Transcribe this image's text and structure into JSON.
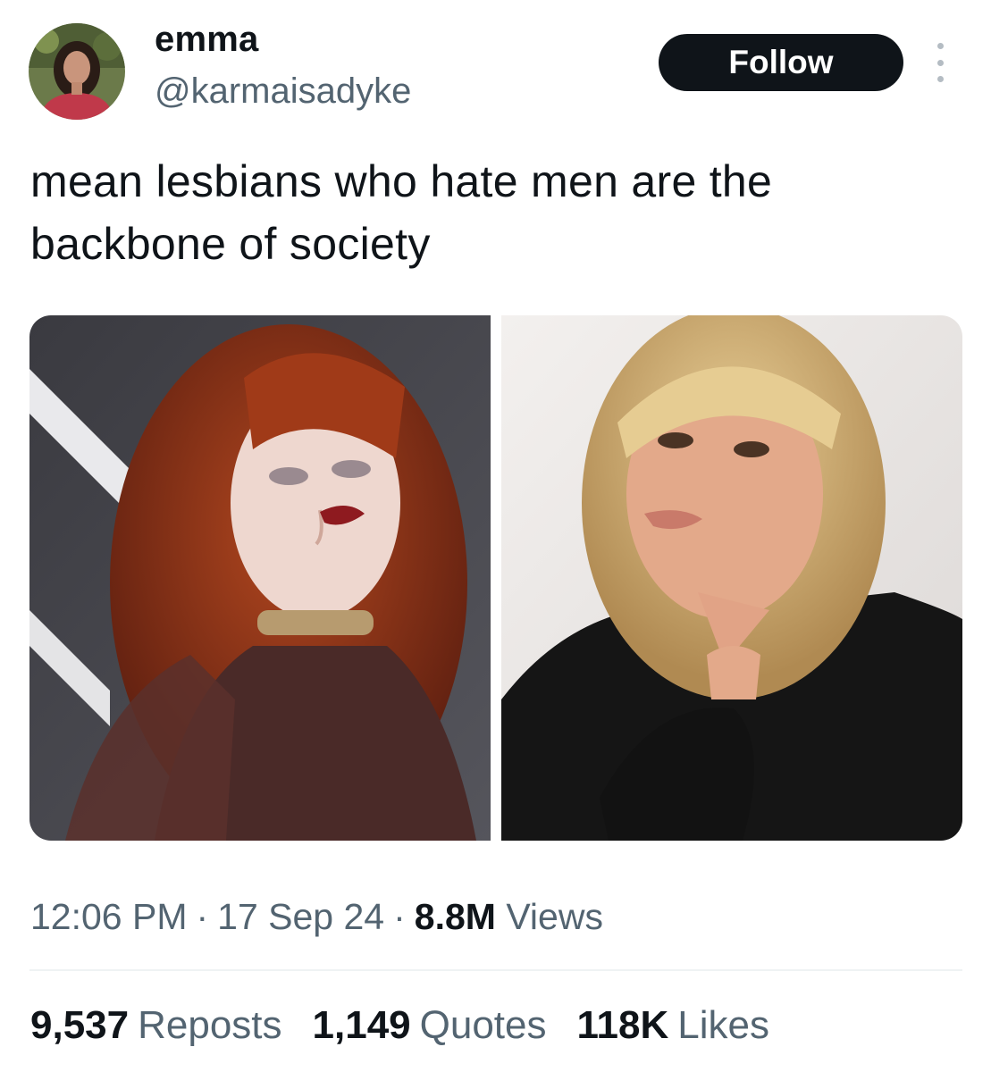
{
  "user": {
    "display_name": "emma",
    "handle": "@karmaisadyke",
    "avatar_icon": "profile-photo"
  },
  "header": {
    "follow_label": "Follow",
    "more_icon": "vertical-ellipsis-icon"
  },
  "tweet": {
    "text_line_1": "mean lesbians who hate men are the",
    "text_line_2": "backbone of society"
  },
  "media": {
    "count": 2
  },
  "meta": {
    "time": "12:06 PM",
    "separator": "·",
    "date": "17 Sep 24",
    "views_count": "8.8M",
    "views_label": "Views"
  },
  "stats": {
    "reposts_count": "9,537",
    "reposts_label": "Reposts",
    "quotes_count": "1,149",
    "quotes_label": "Quotes",
    "likes_count": "118K",
    "likes_label": "Likes"
  },
  "colors": {
    "text_primary": "#0f1419",
    "text_secondary": "#536471",
    "follow_bg": "#0f1419",
    "divider": "#eff3f4"
  }
}
